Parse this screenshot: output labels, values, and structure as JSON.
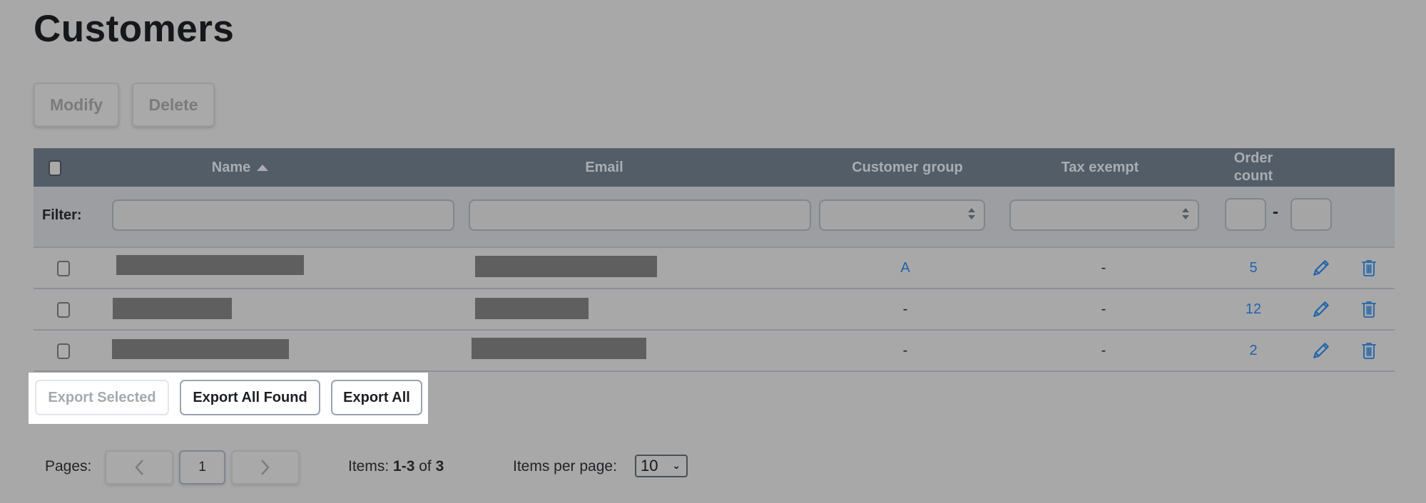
{
  "page": {
    "title": "Customers"
  },
  "toolbar": {
    "modify_label": "Modify",
    "delete_label": "Delete"
  },
  "table": {
    "columns": {
      "name": "Name",
      "email": "Email",
      "customer_group": "Customer group",
      "tax_exempt": "Tax exempt",
      "order_count_line1": "Order",
      "order_count_line2": "count"
    },
    "sort": {
      "column": "Name",
      "direction": "ascending",
      "icon": "sort-asc-icon"
    },
    "filter": {
      "label": "Filter:",
      "name_value": "",
      "email_value": "",
      "customer_group_value": "",
      "tax_exempt_value": "",
      "order_count_min": "",
      "order_count_max": "",
      "range_separator": "-"
    },
    "rows": [
      {
        "name": "[redacted]",
        "email": "[redacted]",
        "customer_group": "A",
        "tax_exempt": "-",
        "order_count": "5"
      },
      {
        "name": "[redacted]",
        "email": "[redacted]",
        "customer_group": "-",
        "tax_exempt": "-",
        "order_count": "12"
      },
      {
        "name": "[redacted]",
        "email": "[redacted]",
        "customer_group": "-",
        "tax_exempt": "-",
        "order_count": "2"
      }
    ],
    "row_actions": {
      "edit_icon": "pencil-icon",
      "delete_icon": "trash-icon"
    }
  },
  "export": {
    "selected_label": "Export Selected",
    "all_found_label": "Export All Found",
    "all_label": "Export All"
  },
  "pagination": {
    "pages_label": "Pages:",
    "current_page": "1",
    "items_prefix": "Items:",
    "items_range": "1-3",
    "items_of": "of",
    "items_total": "3",
    "per_page_label": "Items per page:",
    "per_page_value": "10"
  },
  "colors": {
    "header_bg": "#535d68",
    "link": "#1f64aa",
    "overlay_bg": "#a8a8a8"
  }
}
